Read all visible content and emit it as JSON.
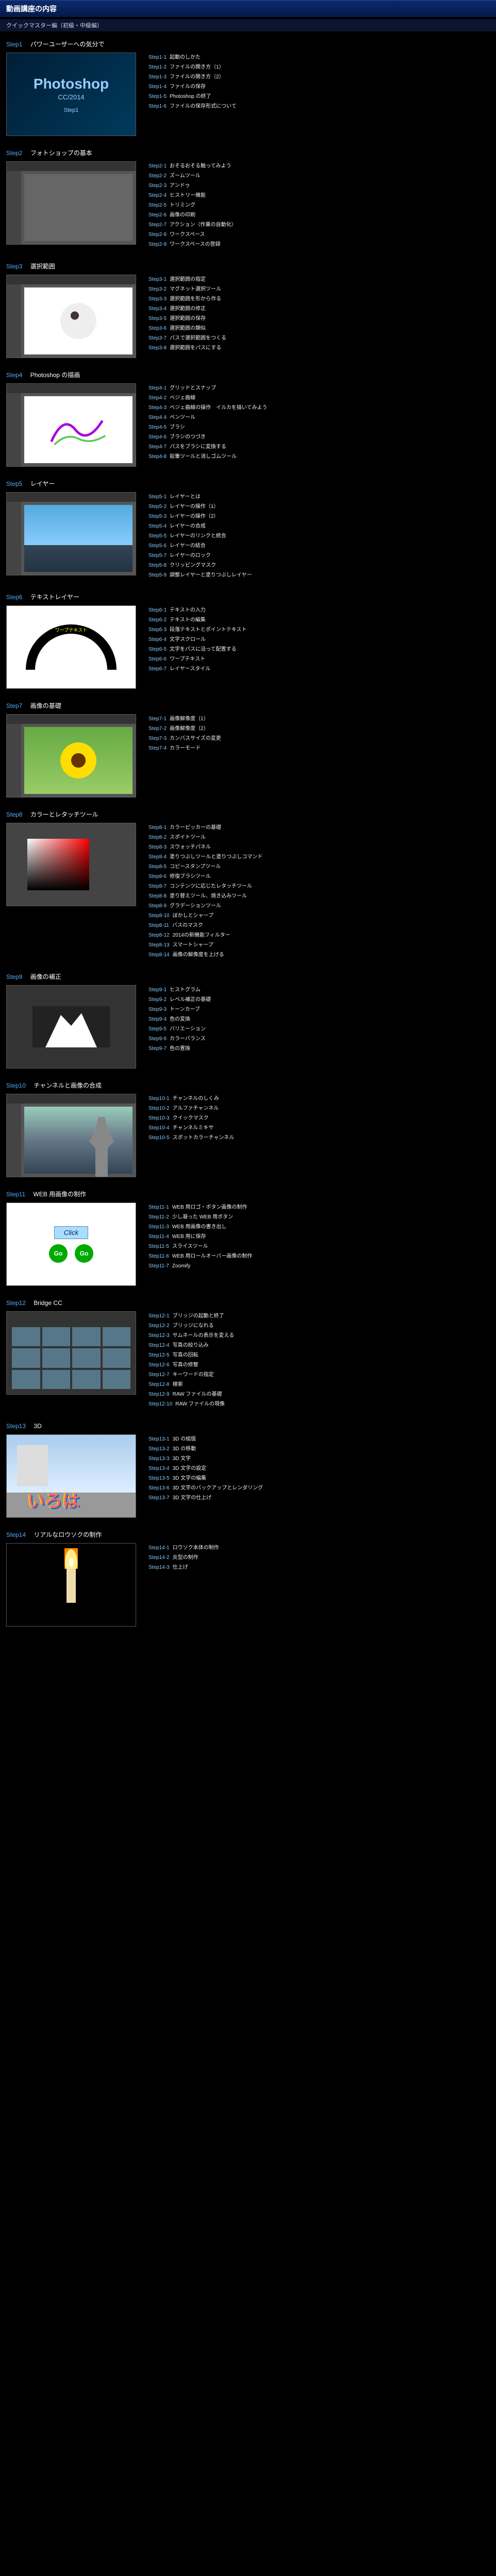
{
  "header": "動画講座の内容",
  "subheader": "クイックマスター編（初級・中級編）",
  "steps": [
    {
      "num": "Step1",
      "title": "パワーユーザーへの気分で",
      "thumb": {
        "type": "ps",
        "l1": "Photoshop",
        "l2": "CC/2014",
        "l3": "Step1"
      },
      "items": [
        {
          "k": "Step1-1",
          "t": "起動のしかた"
        },
        {
          "k": "Step1-2",
          "t": "ファイルの開き方（1）"
        },
        {
          "k": "Step1-3",
          "t": "ファイルの開き方（2）"
        },
        {
          "k": "Step1-4",
          "t": "ファイルの保存"
        },
        {
          "k": "Step1-5",
          "t": "Photoshop の終了"
        },
        {
          "k": "Step1-6",
          "t": "ファイルの保存形式について"
        }
      ]
    },
    {
      "num": "Step2",
      "title": "フォトショップの基本",
      "thumb": {
        "type": "app-blank"
      },
      "items": [
        {
          "k": "Step2-1",
          "t": "おそるおそる触ってみよう"
        },
        {
          "k": "Step2-2",
          "t": "ズームツール"
        },
        {
          "k": "Step2-3",
          "t": "アンドゥ"
        },
        {
          "k": "Step2-4",
          "t": "ヒストリー機能"
        },
        {
          "k": "Step2-5",
          "t": "トリミング"
        },
        {
          "k": "Step2-6",
          "t": "画像の印刷"
        },
        {
          "k": "Step2-7",
          "t": "アクション（作業の自動化）"
        },
        {
          "k": "Step2-8",
          "t": "ワークスペース"
        },
        {
          "k": "Step2-9",
          "t": "ワークスペースの登録"
        }
      ]
    },
    {
      "num": "Step3",
      "title": "選択範囲",
      "thumb": {
        "type": "sheep"
      },
      "items": [
        {
          "k": "Step3-1",
          "t": "選択範囲の指定"
        },
        {
          "k": "Step3-2",
          "t": "マグネット選択ツール"
        },
        {
          "k": "Step3-3",
          "t": "選択範囲を形から作る"
        },
        {
          "k": "Step3-4",
          "t": "選択範囲の修正"
        },
        {
          "k": "Step3-5",
          "t": "選択範囲の保存"
        },
        {
          "k": "Step3-6",
          "t": "選択範囲の類似"
        },
        {
          "k": "Step3-7",
          "t": "パスで選択範囲をつくる"
        },
        {
          "k": "Step3-8",
          "t": "選択範囲をパスにする"
        }
      ]
    },
    {
      "num": "Step4",
      "title": "Photoshop の描画",
      "thumb": {
        "type": "curves"
      },
      "items": [
        {
          "k": "Step4-1",
          "t": "グリッドとスナップ"
        },
        {
          "k": "Step4-2",
          "t": "ベジェ曲線"
        },
        {
          "k": "Step4-3",
          "t": "ベジェ曲線の操作　イルカを描いてみよう"
        },
        {
          "k": "Step4-4",
          "t": "ペンツール"
        },
        {
          "k": "Step4-5",
          "t": "ブラシ"
        },
        {
          "k": "Step4-6",
          "t": "ブラシのつづき"
        },
        {
          "k": "Step4-7",
          "t": "パスをブラシに変換する"
        },
        {
          "k": "Step4-8",
          "t": "鉛筆ツールと消しゴムツール"
        }
      ]
    },
    {
      "num": "Step5",
      "title": "レイヤー",
      "thumb": {
        "type": "sky"
      },
      "items": [
        {
          "k": "Step5-1",
          "t": "レイヤーとは"
        },
        {
          "k": "Step5-2",
          "t": "レイヤーの操作（1）"
        },
        {
          "k": "Step5-3",
          "t": "レイヤーの操作（2）"
        },
        {
          "k": "Step5-4",
          "t": "レイヤーの合成"
        },
        {
          "k": "Step5-5",
          "t": "レイヤーのリンクと統合"
        },
        {
          "k": "Step5-6",
          "t": "レイヤーの結合"
        },
        {
          "k": "Step5-7",
          "t": "レイヤーのロック"
        },
        {
          "k": "Step5-8",
          "t": "クリッピングマスク"
        },
        {
          "k": "Step5-9",
          "t": "調整レイヤーと塗りつぶしレイヤー"
        }
      ]
    },
    {
      "num": "Step6",
      "title": "テキストレイヤー",
      "thumb": {
        "type": "text-arc",
        "label": "ワープテキスト"
      },
      "items": [
        {
          "k": "Step6-1",
          "t": "テキストの入力"
        },
        {
          "k": "Step6-2",
          "t": "テキストの編集"
        },
        {
          "k": "Step6-3",
          "t": "段落テキストとポイントテキスト"
        },
        {
          "k": "Step6-4",
          "t": "文字スクロール"
        },
        {
          "k": "Step6-5",
          "t": "文字をパスに沿って配置する"
        },
        {
          "k": "Step6-6",
          "t": "ワープテキスト"
        },
        {
          "k": "Step6-7",
          "t": "レイヤースタイル"
        }
      ]
    },
    {
      "num": "Step7",
      "title": "画像の基礎",
      "thumb": {
        "type": "sunflower"
      },
      "items": [
        {
          "k": "Step7-1",
          "t": "画像解像度（1）"
        },
        {
          "k": "Step7-2",
          "t": "画像解像度（2）"
        },
        {
          "k": "Step7-3",
          "t": "カンバスサイズの変更"
        },
        {
          "k": "Step7-4",
          "t": "カラーモード"
        }
      ]
    },
    {
      "num": "Step8",
      "title": "カラーとレタッチツール",
      "thumb": {
        "type": "color-picker"
      },
      "items": [
        {
          "k": "Step8-1",
          "t": "カラーピッカーの基礎"
        },
        {
          "k": "Step8-2",
          "t": "スポイトツール"
        },
        {
          "k": "Step8-3",
          "t": "スウォッチパネル"
        },
        {
          "k": "Step8-4",
          "t": "塗りつぶしツールと塗りつぶしコマンド"
        },
        {
          "k": "Step8-5",
          "t": "コピースタンプツール"
        },
        {
          "k": "Step8-6",
          "t": "修復ブラシツール"
        },
        {
          "k": "Step8-7",
          "t": "コンテンツに応じたレタッチツール"
        },
        {
          "k": "Step8-8",
          "t": "塗り替えツール、焼き込みツール"
        },
        {
          "k": "Step8-9",
          "t": "グラデーションツール"
        },
        {
          "k": "Step8-10",
          "t": "ぼかしとシャープ"
        },
        {
          "k": "Step8-11",
          "t": "バスのマスク"
        },
        {
          "k": "Step8-12",
          "t": "2014の新機能フィルター"
        },
        {
          "k": "Step8-13",
          "t": "スマートシャープ"
        },
        {
          "k": "Step8-14",
          "t": "画像の解像度を上げる"
        }
      ]
    },
    {
      "num": "Step9",
      "title": "画像の補正",
      "thumb": {
        "type": "histogram"
      },
      "items": [
        {
          "k": "Step9-1",
          "t": "ヒストグラム"
        },
        {
          "k": "Step9-2",
          "t": "レベル補正の基礎"
        },
        {
          "k": "Step9-3",
          "t": "トーンカーブ"
        },
        {
          "k": "Step9-4",
          "t": "色の変換"
        },
        {
          "k": "Step9-5",
          "t": "バリエーション"
        },
        {
          "k": "Step9-6",
          "t": "カラーバランス"
        },
        {
          "k": "Step9-7",
          "t": "色の置換"
        }
      ]
    },
    {
      "num": "Step10",
      "title": "チャンネルと画像の合成",
      "thumb": {
        "type": "lake"
      },
      "items": [
        {
          "k": "Step10-1",
          "t": "チャンネルのしくみ"
        },
        {
          "k": "Step10-2",
          "t": "アルファチャンネル"
        },
        {
          "k": "Step10-3",
          "t": "クイックマスク"
        },
        {
          "k": "Step10-4",
          "t": "チャンネルミキサ"
        },
        {
          "k": "Step10-5",
          "t": "スポットカラーチャンネル"
        }
      ]
    },
    {
      "num": "Step11",
      "title": "WEB 用画像の制作",
      "thumb": {
        "type": "web",
        "click": "Click",
        "go": "Go"
      },
      "items": [
        {
          "k": "Step11-1",
          "t": "WEB 用ロゴ・ボタン画像の制作"
        },
        {
          "k": "Step11-2",
          "t": "少し凝った WEB 用ボタン"
        },
        {
          "k": "Step11-3",
          "t": "WEB 用画像の書き出し"
        },
        {
          "k": "Step11-4",
          "t": "WEB 用に保存"
        },
        {
          "k": "Step11-5",
          "t": "スライスツール"
        },
        {
          "k": "Step11-6",
          "t": "WEB 用ロールオーバー画像の制作"
        },
        {
          "k": "Step11-7",
          "t": "Zoomify"
        }
      ]
    },
    {
      "num": "Step12",
      "title": "Bridge CC",
      "thumb": {
        "type": "bridge"
      },
      "items": [
        {
          "k": "Step12-1",
          "t": "ブリッジの起動と終了"
        },
        {
          "k": "Step12-2",
          "t": "ブリッジになれる"
        },
        {
          "k": "Step12-3",
          "t": "サムネールの表示を変える"
        },
        {
          "k": "Step12-4",
          "t": "写真の絞り込み"
        },
        {
          "k": "Step12-5",
          "t": "写真の回転"
        },
        {
          "k": "Step12-6",
          "t": "写真の修整"
        },
        {
          "k": "Step12-7",
          "t": "キーワードの指定"
        },
        {
          "k": "Step12-8",
          "t": "検索"
        },
        {
          "k": "Step12-9",
          "t": "RAW ファイルの基礎"
        },
        {
          "k": "Step12-10",
          "t": "RAW ファイルの現像"
        }
      ]
    },
    {
      "num": "Step13",
      "title": "3D",
      "thumb": {
        "type": "3d",
        "txt": "いろは"
      },
      "items": [
        {
          "k": "Step13-1",
          "t": "3D の組版"
        },
        {
          "k": "Step13-2",
          "t": "3D の移動"
        },
        {
          "k": "Step13-3",
          "t": "3D 文字"
        },
        {
          "k": "Step13-4",
          "t": "3D 文字の設定"
        },
        {
          "k": "Step13-5",
          "t": "3D 文字の編集"
        },
        {
          "k": "Step13-6",
          "t": "3D 文字のバックアップとレンダリング"
        },
        {
          "k": "Step13-7",
          "t": "3D 文字の仕上げ"
        }
      ]
    },
    {
      "num": "Step14",
      "title": "リアルなロウソクの制作",
      "thumb": {
        "type": "candle"
      },
      "items": [
        {
          "k": "Step14-1",
          "t": "ロウソク本体の制作"
        },
        {
          "k": "Step14-2",
          "t": "炎型の制作"
        },
        {
          "k": "Step14-3",
          "t": "仕上げ"
        }
      ]
    }
  ]
}
